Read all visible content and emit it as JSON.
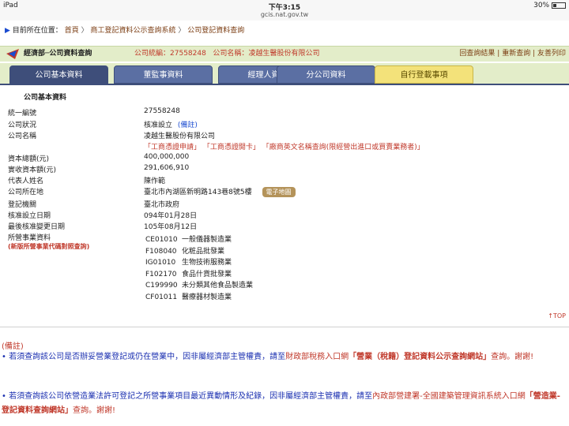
{
  "status_bar": {
    "device": "iPad",
    "time": "下午3:15",
    "url": "gcis.nat.gov.tw",
    "battery": "30%"
  },
  "breadcrumb": {
    "prefix": "目前所在位置：",
    "items": [
      "首頁",
      "商工登記資料公示查詢系統",
      "公司登記資料查詢"
    ],
    "sep": "〉"
  },
  "header": {
    "ministry": "經濟部─公司資料查詢",
    "company_id_label": "公司統編：",
    "company_id": "27558248",
    "company_name_label": "公司名稱：",
    "company_name": "凌越生醫股份有限公司",
    "links": [
      "回查詢結果",
      "重新查詢",
      "友善列印"
    ]
  },
  "tabs": [
    "公司基本資料",
    "董監事資料",
    "經理人資料",
    "分公司資料",
    "自行登載事項"
  ],
  "section_title": "公司基本資料",
  "rows": {
    "id": {
      "label": "統一編號",
      "value": "27558248"
    },
    "status": {
      "label": "公司狀況",
      "value": "核准設立",
      "note": "(備註)"
    },
    "name": {
      "label": "公司名稱",
      "value": "凌越生醫股份有限公司"
    },
    "quote_links": [
      "「工商憑證申請」",
      "「工商憑證開卡」",
      "「廠商英文名稱查詢(限經營出進口或買賣業務者)」"
    ],
    "capital_total": {
      "label": "資本總額(元)",
      "value": "400,000,000"
    },
    "capital_paid": {
      "label": "實收資本額(元)",
      "value": "291,606,910"
    },
    "representative": {
      "label": "代表人姓名",
      "value": "陳作範"
    },
    "address": {
      "label": "公司所在地",
      "value": "臺北市內湖區新明路143巷8號5樓",
      "map_button": "電子地圖"
    },
    "authority": {
      "label": "登記機關",
      "value": "臺北市政府"
    },
    "approved_date": {
      "label": "核准設立日期",
      "value": "094年01月28日"
    },
    "last_change": {
      "label": "最後核准變更日期",
      "value": "105年08月12日"
    },
    "business": {
      "label": "所營事業資料",
      "link": "(新版所營事業代碼對照查詢)"
    }
  },
  "business_items": [
    {
      "code": "CE01010",
      "name": "一般儀器製造業"
    },
    {
      "code": "F108040",
      "name": "化粧品批發業"
    },
    {
      "code": "IG01010",
      "name": "生物技術服務業"
    },
    {
      "code": "F102170",
      "name": "食品什貨批發業"
    },
    {
      "code": "C199990",
      "name": "未分類其他食品製造業"
    },
    {
      "code": "CF01011",
      "name": "醫療器材製造業"
    }
  ],
  "top_link": "↑TOP",
  "footer": {
    "title": "(備註)",
    "note1": {
      "bullet": "•",
      "text_a": " 若須查詢該公司是否辦妥營業登記或仍在營業中，因非屬經濟部主管權責，請至",
      "link_a": "財政部稅務入口網",
      "text_b": "「營業（稅籍）登記資料公示查詢網站」",
      "text_c": "查詢。謝謝!"
    },
    "note2": {
      "bullet": "•",
      "text_a": " 若須查詢該公司依營造業法許可登記之所營事業項目最近異動情形及紀錄，因非屬經濟部主管權責，請至",
      "link_a": "內政部營建署-全國建築管理資訊系統入口網",
      "text_b": "「營造業-登記資料查詢網站」",
      "text_c": "查詢。謝謝!"
    }
  },
  "colors": {
    "header_band": "#e3edc9",
    "tab": "#5b6fa3",
    "tab_active": "#3e4e7a",
    "tab_highlight": "#f3e27a",
    "link_red": "#c0392b",
    "note_blue": "#1a2fb0"
  }
}
